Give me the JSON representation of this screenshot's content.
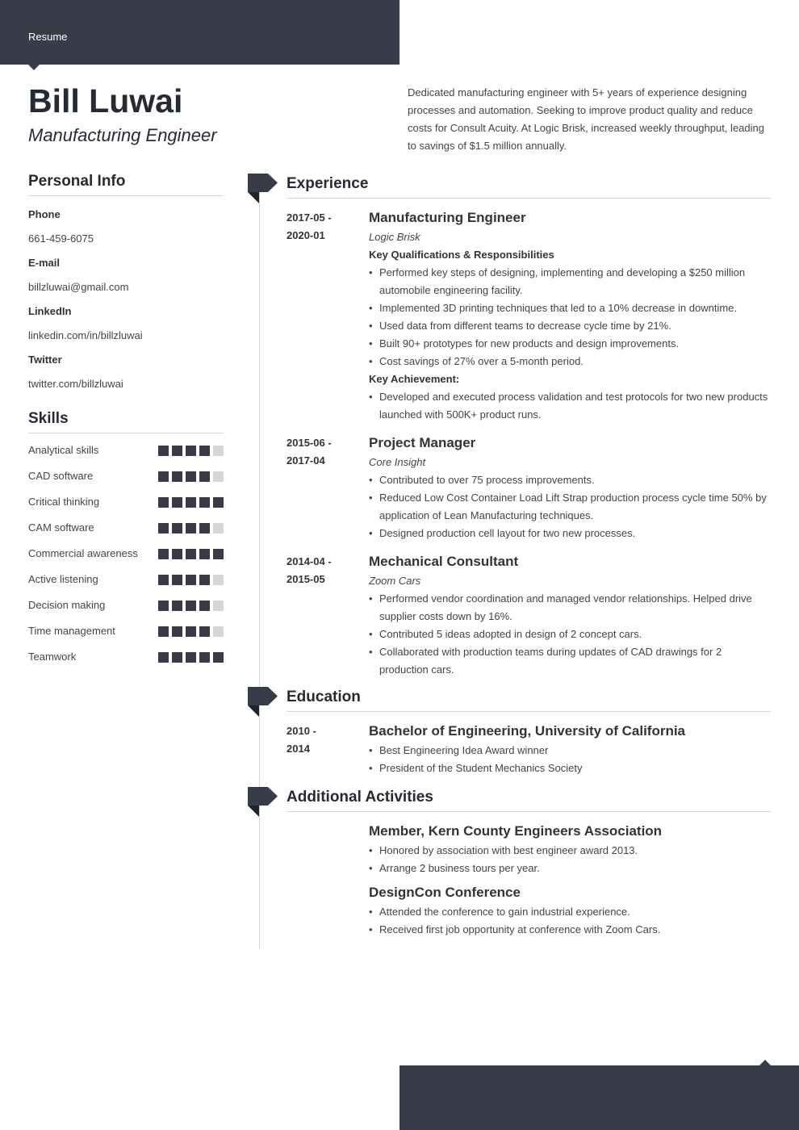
{
  "header": {
    "label": "Resume",
    "name": "Bill Luwai",
    "title": "Manufacturing Engineer",
    "summary": "Dedicated manufacturing engineer with 5+ years of experience designing processes and automation. Seeking to improve product quality and reduce costs for Consult Acuity. At Logic Brisk, increased weekly throughput, leading to savings of $1.5 million annually."
  },
  "colors": {
    "accent": "#373c48",
    "accent_dark": "#1f232b",
    "dot_off": "#d6d6d6",
    "rule": "#d5d5d5"
  },
  "personal_info": {
    "title": "Personal Info",
    "items": [
      {
        "label": "Phone",
        "value": "661-459-6075"
      },
      {
        "label": "E-mail",
        "value": "billzluwai@gmail.com"
      },
      {
        "label": "LinkedIn",
        "value": "linkedin.com/in/billzluwai"
      },
      {
        "label": "Twitter",
        "value": "twitter.com/billzluwai"
      }
    ]
  },
  "skills": {
    "title": "Skills",
    "max_level": 5,
    "items": [
      {
        "name": "Analytical skills",
        "level": 4
      },
      {
        "name": "CAD software",
        "level": 4
      },
      {
        "name": "Critical thinking",
        "level": 5
      },
      {
        "name": "CAM software",
        "level": 4
      },
      {
        "name": "Commercial awareness",
        "level": 5
      },
      {
        "name": "Active listening",
        "level": 4
      },
      {
        "name": "Decision making",
        "level": 4
      },
      {
        "name": "Time management",
        "level": 4
      },
      {
        "name": "Teamwork",
        "level": 5
      }
    ]
  },
  "experience": {
    "title": "Experience",
    "entries": [
      {
        "date_start": "2017-05 -",
        "date_end": "2020-01",
        "title": "Manufacturing Engineer",
        "company": "Logic Brisk",
        "groups": [
          {
            "heading": "Key Qualifications & Responsibilities",
            "bullets": [
              "Performed key steps of designing, implementing and developing a $250 million automobile engineering facility.",
              "Implemented 3D printing techniques that led to a 10% decrease in downtime.",
              "Used data from different teams to decrease cycle time by 21%.",
              "Built 90+ prototypes for new products and design improvements.",
              "Cost savings of 27% over a 5-month period."
            ]
          },
          {
            "heading": "Key Achievement:",
            "bullets": [
              "Developed and executed process validation and test protocols for two new products launched with 500K+ product runs."
            ]
          }
        ]
      },
      {
        "date_start": "2015-06 -",
        "date_end": "2017-04",
        "title": "Project Manager",
        "company": "Core Insight",
        "groups": [
          {
            "heading": "",
            "bullets": [
              "Contributed to over 75 process improvements.",
              "Reduced Low Cost Container Load Lift Strap production process cycle time 50% by application of Lean Manufacturing techniques.",
              "Designed production cell layout for two new processes."
            ]
          }
        ]
      },
      {
        "date_start": "2014-04 -",
        "date_end": "2015-05",
        "title": "Mechanical Consultant",
        "company": "Zoom Cars",
        "groups": [
          {
            "heading": "",
            "bullets": [
              "Performed vendor coordination and managed vendor relationships. Helped drive supplier costs down by 16%.",
              "Contributed 5 ideas adopted in design of 2 concept cars.",
              "Collaborated with production teams during updates of CAD drawings for 2 production cars."
            ]
          }
        ]
      }
    ]
  },
  "education": {
    "title": "Education",
    "entries": [
      {
        "date_start": "2010 -",
        "date_end": "2014",
        "title": "Bachelor of Engineering, University of California",
        "bullets": [
          "Best Engineering Idea Award winner",
          "President of the Student Mechanics Society"
        ]
      }
    ]
  },
  "activities": {
    "title": "Additional Activities",
    "entries": [
      {
        "title": "Member, Kern County Engineers Association",
        "bullets": [
          "Honored by association with best engineer award 2013.",
          "Arrange 2 business tours per year."
        ]
      },
      {
        "title": "DesignCon Conference",
        "bullets": [
          "Attended the conference to gain industrial experience.",
          "Received first job opportunity at conference with Zoom Cars."
        ]
      }
    ]
  }
}
